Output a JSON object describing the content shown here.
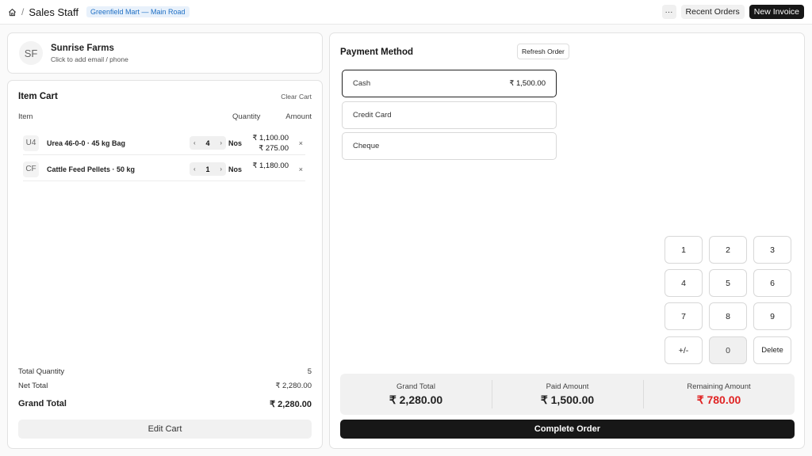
{
  "topbar": {
    "separator": "/",
    "title": "Sales Staff",
    "store": "Greenfield Mart — Main Road",
    "more_label": "···",
    "recent_orders": "Recent Orders",
    "new_invoice": "New Invoice"
  },
  "customer": {
    "initials": "SF",
    "name": "Sunrise Farms",
    "hint": "Click to add email / phone"
  },
  "cart": {
    "title": "Item Cart",
    "clear_label": "Clear Cart",
    "columns": {
      "item": "Item",
      "quantity": "Quantity",
      "amount": "Amount"
    },
    "items": [
      {
        "initials": "U4",
        "name": "Urea 46-0-0 · 45 kg Bag",
        "qty": "4",
        "uom": "Nos",
        "amount": "₹ 1,100.00",
        "rate": "₹ 275.00"
      },
      {
        "initials": "CF",
        "name": "Cattle Feed Pellets · 50 kg",
        "qty": "1",
        "uom": "Nos",
        "amount": "₹ 1,180.00",
        "rate": ""
      }
    ],
    "stepper_dec": "‹",
    "stepper_inc": "›",
    "remove_label": "×",
    "total_quantity_label": "Total Quantity",
    "total_quantity": "5",
    "net_total_label": "Net Total",
    "net_total": "₹ 2,280.00",
    "grand_total_label": "Grand Total",
    "grand_total": "₹ 2,280.00",
    "edit_label": "Edit Cart"
  },
  "payment": {
    "title": "Payment Method",
    "refresh_label": "Refresh Order",
    "methods": [
      {
        "name": "Cash",
        "value": "₹ 1,500.00"
      },
      {
        "name": "Credit Card",
        "value": ""
      },
      {
        "name": "Cheque",
        "value": ""
      }
    ],
    "keypad": [
      "1",
      "2",
      "3",
      "4",
      "5",
      "6",
      "7",
      "8",
      "9",
      "+/-",
      "0",
      "Delete"
    ],
    "summary": {
      "grand_total_label": "Grand Total",
      "grand_total": "₹ 2,280.00",
      "paid_label": "Paid Amount",
      "paid": "₹ 1,500.00",
      "remaining_label": "Remaining Amount",
      "remaining": "₹ 780.00"
    },
    "complete_label": "Complete Order"
  },
  "colors": {
    "accent": "#171717",
    "remaining": "#e02424",
    "badge_text": "#1f6fc4",
    "badge_bg": "#e8f1fb"
  }
}
